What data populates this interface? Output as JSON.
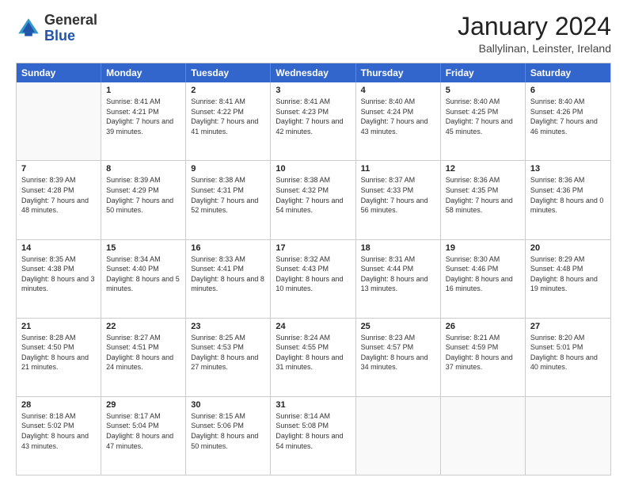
{
  "logo": {
    "general": "General",
    "blue": "Blue"
  },
  "header": {
    "month": "January 2024",
    "location": "Ballylinan, Leinster, Ireland"
  },
  "days": [
    "Sunday",
    "Monday",
    "Tuesday",
    "Wednesday",
    "Thursday",
    "Friday",
    "Saturday"
  ],
  "weeks": [
    [
      {
        "day": "",
        "empty": true
      },
      {
        "day": "1",
        "sunrise": "Sunrise: 8:41 AM",
        "sunset": "Sunset: 4:21 PM",
        "daylight": "Daylight: 7 hours and 39 minutes."
      },
      {
        "day": "2",
        "sunrise": "Sunrise: 8:41 AM",
        "sunset": "Sunset: 4:22 PM",
        "daylight": "Daylight: 7 hours and 41 minutes."
      },
      {
        "day": "3",
        "sunrise": "Sunrise: 8:41 AM",
        "sunset": "Sunset: 4:23 PM",
        "daylight": "Daylight: 7 hours and 42 minutes."
      },
      {
        "day": "4",
        "sunrise": "Sunrise: 8:40 AM",
        "sunset": "Sunset: 4:24 PM",
        "daylight": "Daylight: 7 hours and 43 minutes."
      },
      {
        "day": "5",
        "sunrise": "Sunrise: 8:40 AM",
        "sunset": "Sunset: 4:25 PM",
        "daylight": "Daylight: 7 hours and 45 minutes."
      },
      {
        "day": "6",
        "sunrise": "Sunrise: 8:40 AM",
        "sunset": "Sunset: 4:26 PM",
        "daylight": "Daylight: 7 hours and 46 minutes."
      }
    ],
    [
      {
        "day": "7",
        "sunrise": "Sunrise: 8:39 AM",
        "sunset": "Sunset: 4:28 PM",
        "daylight": "Daylight: 7 hours and 48 minutes."
      },
      {
        "day": "8",
        "sunrise": "Sunrise: 8:39 AM",
        "sunset": "Sunset: 4:29 PM",
        "daylight": "Daylight: 7 hours and 50 minutes."
      },
      {
        "day": "9",
        "sunrise": "Sunrise: 8:38 AM",
        "sunset": "Sunset: 4:31 PM",
        "daylight": "Daylight: 7 hours and 52 minutes."
      },
      {
        "day": "10",
        "sunrise": "Sunrise: 8:38 AM",
        "sunset": "Sunset: 4:32 PM",
        "daylight": "Daylight: 7 hours and 54 minutes."
      },
      {
        "day": "11",
        "sunrise": "Sunrise: 8:37 AM",
        "sunset": "Sunset: 4:33 PM",
        "daylight": "Daylight: 7 hours and 56 minutes."
      },
      {
        "day": "12",
        "sunrise": "Sunrise: 8:36 AM",
        "sunset": "Sunset: 4:35 PM",
        "daylight": "Daylight: 7 hours and 58 minutes."
      },
      {
        "day": "13",
        "sunrise": "Sunrise: 8:36 AM",
        "sunset": "Sunset: 4:36 PM",
        "daylight": "Daylight: 8 hours and 0 minutes."
      }
    ],
    [
      {
        "day": "14",
        "sunrise": "Sunrise: 8:35 AM",
        "sunset": "Sunset: 4:38 PM",
        "daylight": "Daylight: 8 hours and 3 minutes."
      },
      {
        "day": "15",
        "sunrise": "Sunrise: 8:34 AM",
        "sunset": "Sunset: 4:40 PM",
        "daylight": "Daylight: 8 hours and 5 minutes."
      },
      {
        "day": "16",
        "sunrise": "Sunrise: 8:33 AM",
        "sunset": "Sunset: 4:41 PM",
        "daylight": "Daylight: 8 hours and 8 minutes."
      },
      {
        "day": "17",
        "sunrise": "Sunrise: 8:32 AM",
        "sunset": "Sunset: 4:43 PM",
        "daylight": "Daylight: 8 hours and 10 minutes."
      },
      {
        "day": "18",
        "sunrise": "Sunrise: 8:31 AM",
        "sunset": "Sunset: 4:44 PM",
        "daylight": "Daylight: 8 hours and 13 minutes."
      },
      {
        "day": "19",
        "sunrise": "Sunrise: 8:30 AM",
        "sunset": "Sunset: 4:46 PM",
        "daylight": "Daylight: 8 hours and 16 minutes."
      },
      {
        "day": "20",
        "sunrise": "Sunrise: 8:29 AM",
        "sunset": "Sunset: 4:48 PM",
        "daylight": "Daylight: 8 hours and 19 minutes."
      }
    ],
    [
      {
        "day": "21",
        "sunrise": "Sunrise: 8:28 AM",
        "sunset": "Sunset: 4:50 PM",
        "daylight": "Daylight: 8 hours and 21 minutes."
      },
      {
        "day": "22",
        "sunrise": "Sunrise: 8:27 AM",
        "sunset": "Sunset: 4:51 PM",
        "daylight": "Daylight: 8 hours and 24 minutes."
      },
      {
        "day": "23",
        "sunrise": "Sunrise: 8:25 AM",
        "sunset": "Sunset: 4:53 PM",
        "daylight": "Daylight: 8 hours and 27 minutes."
      },
      {
        "day": "24",
        "sunrise": "Sunrise: 8:24 AM",
        "sunset": "Sunset: 4:55 PM",
        "daylight": "Daylight: 8 hours and 31 minutes."
      },
      {
        "day": "25",
        "sunrise": "Sunrise: 8:23 AM",
        "sunset": "Sunset: 4:57 PM",
        "daylight": "Daylight: 8 hours and 34 minutes."
      },
      {
        "day": "26",
        "sunrise": "Sunrise: 8:21 AM",
        "sunset": "Sunset: 4:59 PM",
        "daylight": "Daylight: 8 hours and 37 minutes."
      },
      {
        "day": "27",
        "sunrise": "Sunrise: 8:20 AM",
        "sunset": "Sunset: 5:01 PM",
        "daylight": "Daylight: 8 hours and 40 minutes."
      }
    ],
    [
      {
        "day": "28",
        "sunrise": "Sunrise: 8:18 AM",
        "sunset": "Sunset: 5:02 PM",
        "daylight": "Daylight: 8 hours and 43 minutes."
      },
      {
        "day": "29",
        "sunrise": "Sunrise: 8:17 AM",
        "sunset": "Sunset: 5:04 PM",
        "daylight": "Daylight: 8 hours and 47 minutes."
      },
      {
        "day": "30",
        "sunrise": "Sunrise: 8:15 AM",
        "sunset": "Sunset: 5:06 PM",
        "daylight": "Daylight: 8 hours and 50 minutes."
      },
      {
        "day": "31",
        "sunrise": "Sunrise: 8:14 AM",
        "sunset": "Sunset: 5:08 PM",
        "daylight": "Daylight: 8 hours and 54 minutes."
      },
      {
        "day": "",
        "empty": true
      },
      {
        "day": "",
        "empty": true
      },
      {
        "day": "",
        "empty": true
      }
    ]
  ]
}
